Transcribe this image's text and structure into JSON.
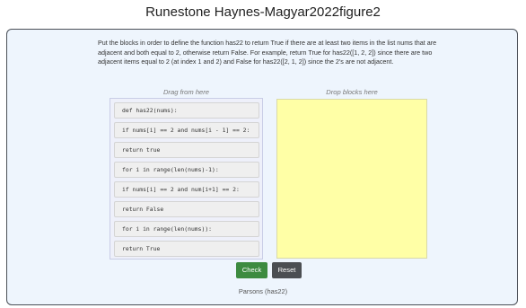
{
  "page": {
    "title": "Runestone Haynes-Magyar2022figure2"
  },
  "problem": {
    "instructions": "Put the blocks in order to define the function has22 to return True if there are at least two items in the list nums that are adjacent and both equal to 2, otherwise return False. For example, return True for has22([1, 2, 2]) since there are two adjacent items equal to 2 (at index 1 and 2) and False for has22([2, 1, 2]) since the 2's are not adjacent.",
    "source_label": "Drag from here",
    "target_label": "Drop blocks here",
    "blocks": [
      "def has22(nums):",
      "if nums[i] == 2 and nums[i - 1] == 2:",
      "return true",
      "for i in range(len(nums)-1):",
      "if nums[i] == 2 and num[i+1] == 2:",
      "return False",
      "for i in range(len(nums)):",
      "return True"
    ],
    "check_label": "Check",
    "reset_label": "Reset",
    "footer": "Parsons (has22)"
  },
  "colors": {
    "card_background": "#eef5fd",
    "drop_zone": "#ffffa6",
    "check_button": "#3d8b40",
    "reset_button": "#4b4e52"
  }
}
